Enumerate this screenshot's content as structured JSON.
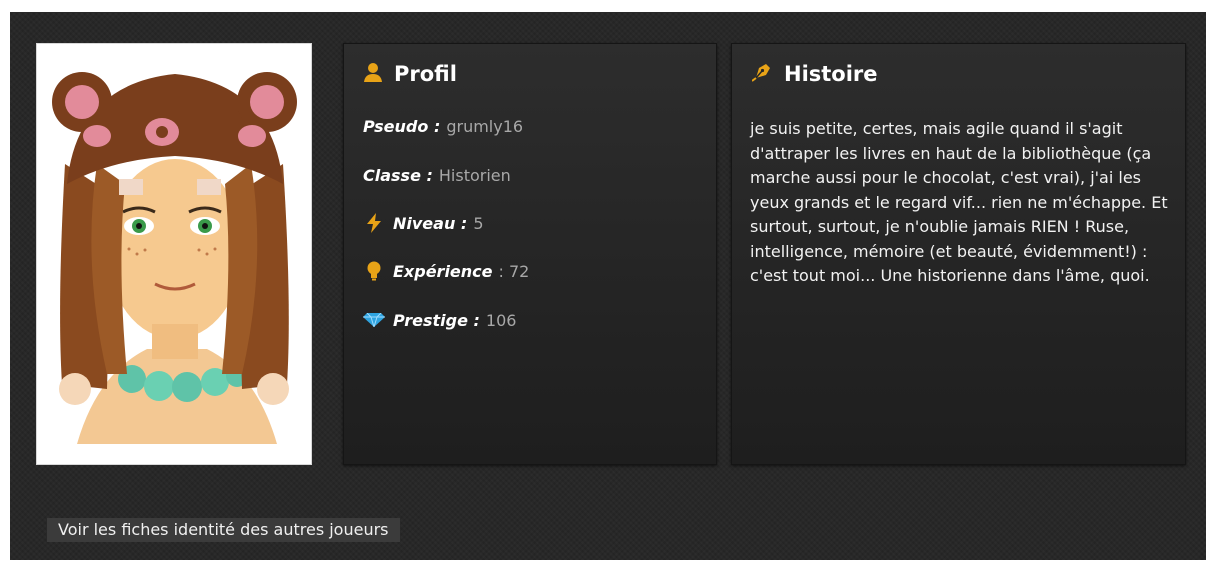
{
  "profile": {
    "title": "Profil",
    "pseudo": {
      "label": "Pseudo :",
      "value": "grumly16"
    },
    "classe": {
      "label": "Classe :",
      "value": "Historien"
    },
    "niveau": {
      "label": "Niveau :",
      "value": "5"
    },
    "experience": {
      "label": "Expérience",
      "value": ": 72"
    },
    "prestige": {
      "label": "Prestige :",
      "value": "106"
    }
  },
  "histoire": {
    "title": "Histoire",
    "text": "je suis petite, certes, mais agile quand il s'agit d'attraper les livres en haut de la bibliothèque (ça marche aussi pour le chocolat, c'est vrai), j'ai les yeux grands et le regard vif... rien ne m'échappe. Et surtout, surtout, je n'oublie jamais RIEN ! Ruse, intelligence, mémoire (et beauté, évidemment!) : c'est tout moi... Une historienne dans l'âme, quoi."
  },
  "footer": {
    "button_label": "Voir les fiches identité des autres joueurs"
  },
  "colors": {
    "accent": "#e8a317",
    "diamond": "#2fa4e0",
    "background": "#262626"
  },
  "icons": [
    "user-icon",
    "pen-icon",
    "lightning-icon",
    "bulb-icon",
    "diamond-icon"
  ]
}
